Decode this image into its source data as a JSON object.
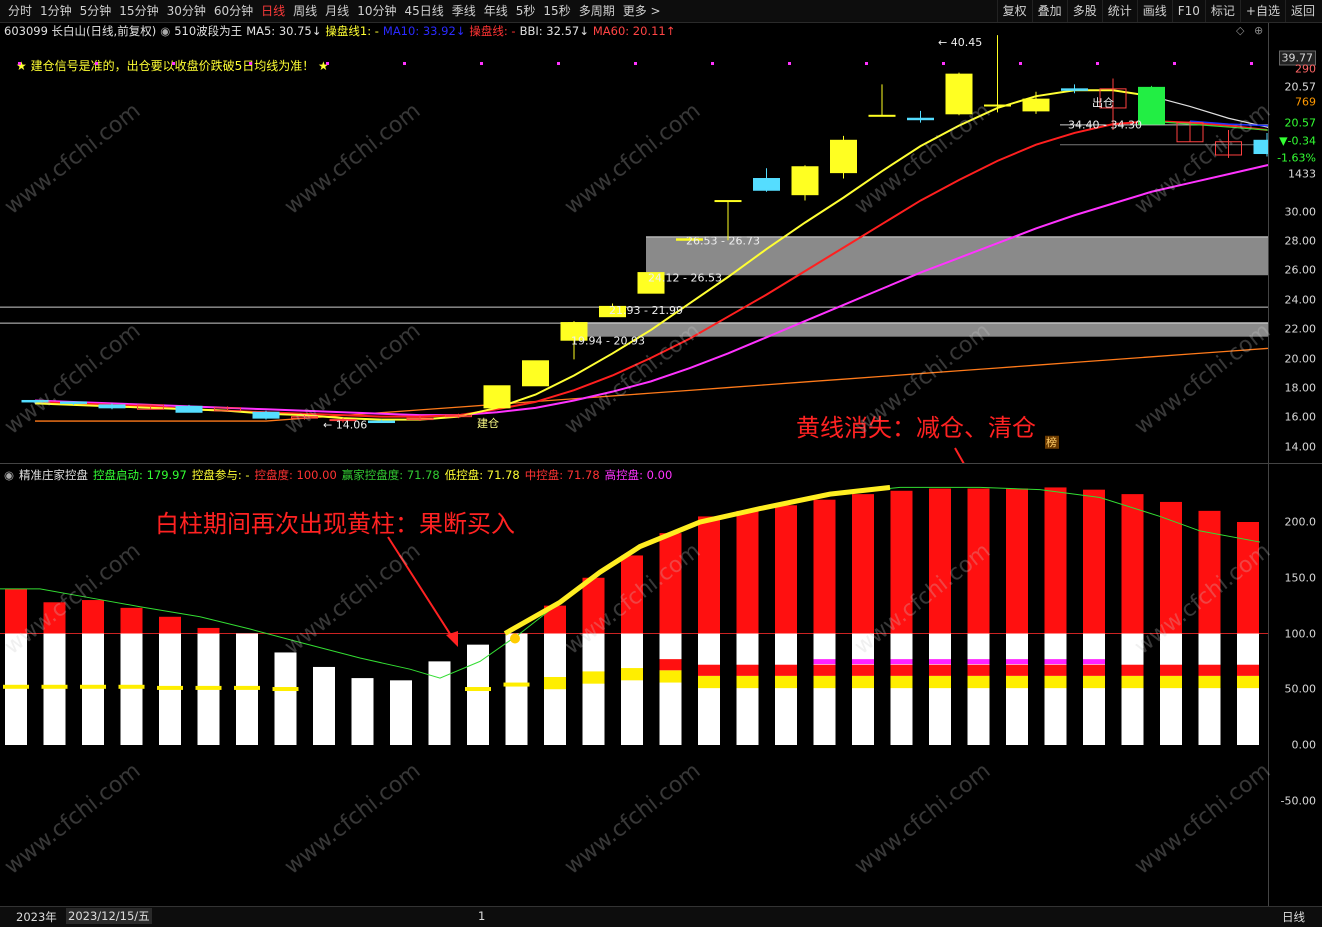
{
  "toolbar": {
    "tabs": [
      "分时",
      "1分钟",
      "5分钟",
      "15分钟",
      "30分钟",
      "60分钟",
      "日线",
      "周线",
      "月线",
      "10分钟",
      "45日线",
      "季线",
      "年线",
      "5秒",
      "15秒",
      "多周期",
      "更多 >"
    ],
    "active_index": 6,
    "tools": [
      "复权",
      "叠加",
      "多股",
      "统计",
      "画线",
      "F10",
      "标记",
      "+自选",
      "返回"
    ]
  },
  "header": {
    "stock": "603099 长白山(日线,前复权)",
    "indicator_name": "510波段为王",
    "ma5": "MA5: 30.75↓",
    "cp1": "操盘线1: -",
    "ma10": "MA10: 33.92↓",
    "cp": "操盘线: -",
    "bbi": "BBI: 32.57↓",
    "ma60": "MA60: 20.11↑"
  },
  "notice": "★ 建仓信号是准的，出仓要以收盘价跌破5日均线为准！ ★",
  "price_axis": [
    "20.57",
    "769",
    "20.57",
    "▼-0.34",
    "-1.63%",
    "1433",
    "30.00",
    "28.00",
    "26.00",
    "24.00",
    "22.00",
    "20.00",
    "18.00",
    "16.00",
    "14.00"
  ],
  "price_axis_top": [
    "39.77",
    "290"
  ],
  "zones": [
    "26.53 - 26.73",
    "24.12 - 26.53",
    "21.93 - 21.99",
    "19.94 - 20.93"
  ],
  "chart_labels": {
    "hi": "← 40.45",
    "lo": "← 14.06",
    "jiancang": "建仓",
    "chucang": "出仓",
    "chu_vals": "34.40 - 34.30",
    "bang": "榜"
  },
  "lower_header": {
    "name": "精准庄家控盘",
    "a": "控盘启动: 179.97",
    "b": "控盘参与: -",
    "c": "控盘度: 100.00",
    "d": "赢家控盘度: 71.78",
    "e": "低控盘: 71.78",
    "f": "中控盘: 71.78",
    "g": "高控盘: 0.00"
  },
  "lower_axis": [
    "200.0",
    "150.0",
    "100.0",
    "50.00",
    "0.00",
    "-50.00"
  ],
  "annotations": {
    "top": "黄线消失：减仓、清仓",
    "bottom": "白柱期间再次出现黄柱：果断买入"
  },
  "footer": {
    "year": "2023年",
    "date": "2023/12/15/五",
    "mark": "1",
    "period": "日线"
  },
  "watermark": "www.cfchi.com",
  "chart_data": {
    "type": "candlestick",
    "candles": [
      [
        15.6,
        15.5,
        15.6,
        15.4
      ],
      [
        15.5,
        15.4,
        15.5,
        15.3
      ],
      [
        15.3,
        15.1,
        15.4,
        15.0
      ],
      [
        15.0,
        15.3,
        15.3,
        15.0
      ],
      [
        15.2,
        14.8,
        15.3,
        14.8
      ],
      [
        14.9,
        15.1,
        15.2,
        14.9
      ],
      [
        14.8,
        14.4,
        14.9,
        14.3
      ],
      [
        14.4,
        14.5,
        14.6,
        14.3
      ],
      [
        14.3,
        14.3,
        14.4,
        14.1
      ],
      [
        14.2,
        14.1,
        14.3,
        14.1
      ],
      [
        14.3,
        14.4,
        14.6,
        14.2
      ],
      [
        14.5,
        14.6,
        14.7,
        14.4
      ],
      [
        15.1,
        16.6,
        16.6,
        15.1
      ],
      [
        16.6,
        18.3,
        18.3,
        16.6
      ],
      [
        19.7,
        20.9,
        21.0,
        18.4
      ],
      [
        21.3,
        22.0,
        22.2,
        21.3
      ],
      [
        22.9,
        24.3,
        24.3,
        22.9
      ],
      [
        26.5,
        26.6,
        26.7,
        26.5
      ],
      [
        29.2,
        29.2,
        29.2,
        26.5
      ],
      [
        30.7,
        29.9,
        31.4,
        29.8
      ],
      [
        29.6,
        31.5,
        31.6,
        29.2
      ],
      [
        31.1,
        33.3,
        33.6,
        30.7
      ],
      [
        35.0,
        35.0,
        37.1,
        35.0
      ],
      [
        34.8,
        34.7,
        35.3,
        34.5
      ],
      [
        35.1,
        37.8,
        37.9,
        35.0
      ],
      [
        35.7,
        35.7,
        40.45,
        35.2
      ],
      [
        35.3,
        36.1,
        36.6,
        35.1
      ],
      [
        36.8,
        36.7,
        37.1,
        36.5
      ],
      [
        35.5,
        36.8,
        37.5,
        34.0
      ],
      [
        34.4,
        36.9,
        37.0,
        34.4
      ],
      [
        33.2,
        34.5,
        34.6,
        33.2
      ],
      [
        32.3,
        33.2,
        34.0,
        32.1
      ],
      [
        33.3,
        32.4,
        33.8,
        32.2
      ],
      [
        31.5,
        33.3,
        33.5,
        30.4
      ],
      [
        30.0,
        28.3,
        30.8,
        28.3
      ],
      [
        28.5,
        28.4,
        29.3,
        28.3
      ]
    ],
    "ma5_close": 30.75,
    "ma60": 20.11,
    "lower": {
      "red": [
        140,
        128,
        130,
        123,
        115,
        105,
        null,
        null,
        null,
        null,
        null,
        null,
        null,
        null,
        125,
        150,
        170,
        190,
        205,
        210,
        215,
        220,
        225,
        228,
        230,
        230,
        230,
        231,
        229,
        225,
        218,
        210,
        200,
        190,
        180,
        175
      ],
      "white_to": [
        100,
        100,
        100,
        100,
        100,
        100,
        100,
        83,
        70,
        60,
        58,
        75,
        90,
        100,
        100,
        100,
        100,
        100,
        100,
        100,
        100,
        100,
        100,
        100,
        100,
        100,
        100,
        100,
        100,
        100,
        100,
        100,
        100,
        100,
        100,
        100
      ],
      "yellow_mid": [
        52,
        52,
        52,
        52,
        51,
        51,
        51,
        50,
        null,
        null,
        null,
        null,
        50,
        54,
        54,
        59,
        62,
        60,
        55,
        55,
        55,
        55,
        55,
        55,
        55,
        55,
        55,
        55,
        55,
        55,
        55,
        55,
        55,
        55,
        55,
        55
      ]
    }
  }
}
